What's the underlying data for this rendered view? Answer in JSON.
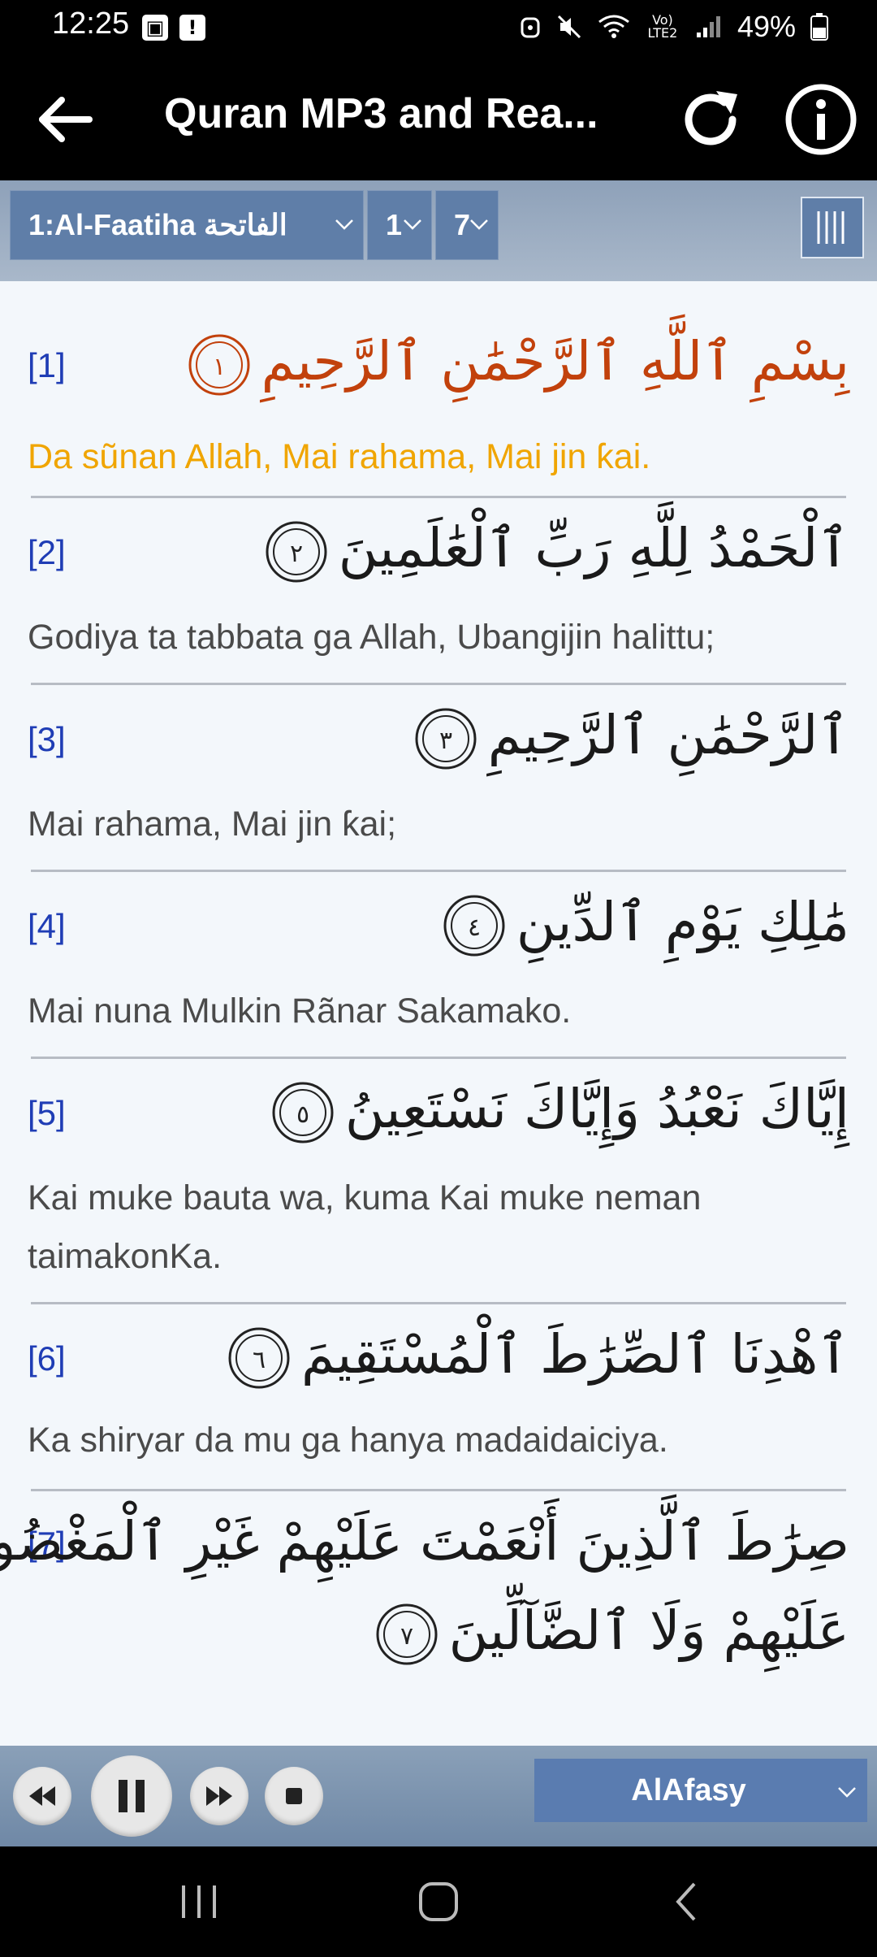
{
  "status": {
    "time": "12:25",
    "battery": "49%",
    "network_label": "Vo) LTE2"
  },
  "appbar": {
    "title": "Quran MP3 and Rea..."
  },
  "selectors": {
    "surah": "1:Al-Faatiha الفاتحة",
    "verse": "1",
    "last": "7"
  },
  "verses": [
    {
      "num": "[1]",
      "arabic": "بِسْمِ ٱللَّهِ ٱلرَّحْمَٰنِ ٱلرَّحِيمِ",
      "mark": "١",
      "translation": "Da sũnan Allah, Mai rahama, Mai jin ƙai."
    },
    {
      "num": "[2]",
      "arabic": "ٱلْحَمْدُ لِلَّهِ رَبِّ ٱلْعَٰلَمِينَ",
      "mark": "٢",
      "translation": "Godiya ta tabbata ga Allah, Ubangijin halittu;"
    },
    {
      "num": "[3]",
      "arabic": "ٱلرَّحْمَٰنِ ٱلرَّحِيمِ",
      "mark": "٣",
      "translation": "Mai rahama, Mai jin ƙai;"
    },
    {
      "num": "[4]",
      "arabic": "مَٰلِكِ يَوْمِ ٱلدِّينِ",
      "mark": "٤",
      "translation": "Mai nuna Mulkin Rãnar Sakamako."
    },
    {
      "num": "[5]",
      "arabic": "إِيَّاكَ نَعْبُدُ وَإِيَّاكَ نَسْتَعِينُ",
      "mark": "٥",
      "translation": "Kai muke bauta wa, kuma Kai muke neman taimakonKa."
    },
    {
      "num": "[6]",
      "arabic": "ٱهْدِنَا ٱلصِّرَٰطَ ٱلْمُسْتَقِيمَ",
      "mark": "٦",
      "translation": "Ka shiryar da mu ga hanya madaidaiciya."
    },
    {
      "num": "[7]",
      "arabic": "صِرَٰطَ ٱلَّذِينَ أَنْعَمْتَ عَلَيْهِمْ غَيْرِ ٱلْمَغْضُوبِ",
      "arabic2": "عَلَيْهِمْ وَلَا ٱلضَّآلِّينَ",
      "mark": "٧"
    }
  ],
  "player": {
    "reciter": "AlAfasy"
  },
  "colors": {
    "highlight_arabic": "#c2410c",
    "highlight_translation": "#f0a500",
    "verse_number": "#1f3db5"
  }
}
